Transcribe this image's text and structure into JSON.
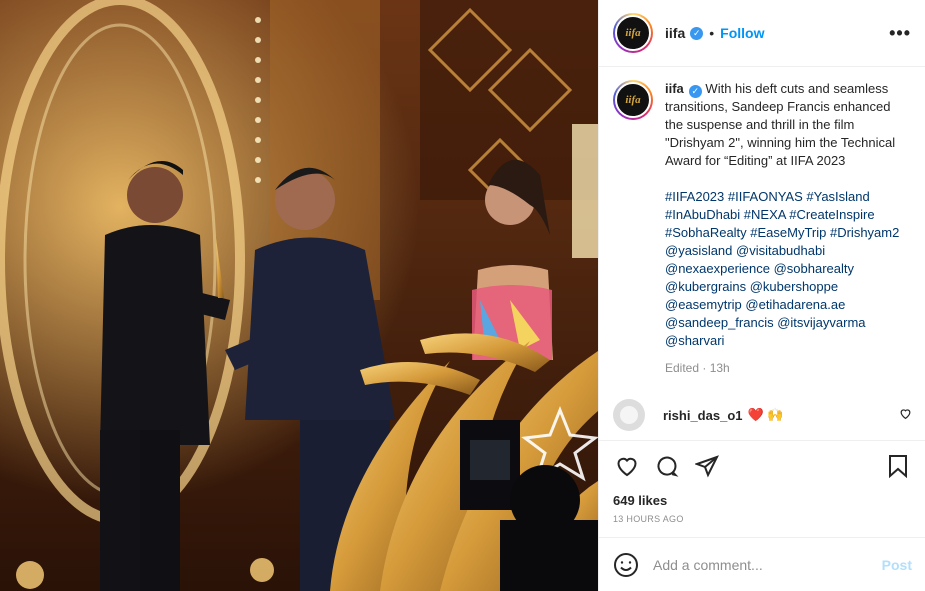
{
  "post": {
    "account": "iifa",
    "avatar_text": "iifa",
    "follow_label": "Follow",
    "separator": "•",
    "more_label": "•••",
    "verified_icon": "verified-badge-icon",
    "caption_text": "With his deft cuts and seamless transitions, Sandeep Francis enhanced the suspense and thrill in the film \"Drishyam 2\", winning him the Technical Award for “Editing” at IIFA 2023",
    "hashtags_text": "#IIFA2023 #IIFAONYAS #YasIsland #InAbuDhabi #NEXA #CreateInspire #SobhaRealty #EaseMyTrip #Drishyam2 @yasisland @visitabudhabi @nexaexperience @sobharealty @kubergrains @kubershoppe @easemytrip @etihadarena.ae @sandeep_francis @itsvijayvarma @sharvari",
    "edited": "Edited · 13h"
  },
  "comment": {
    "user": "rishi_das_o1",
    "text": "❤️ 🙌"
  },
  "actions": {
    "likes": "649 likes",
    "time": "13 HOURS AGO",
    "icons": [
      "heart-icon",
      "comment-icon",
      "share-icon",
      "bookmark-icon"
    ]
  },
  "add_comment": {
    "placeholder": "Add a comment...",
    "post_label": "Post"
  },
  "colors": {
    "link_blue": "#0095f6",
    "hashtag_blue": "#00376b",
    "post_disabled": "#b2dffc",
    "muted": "#8e8e8e"
  }
}
